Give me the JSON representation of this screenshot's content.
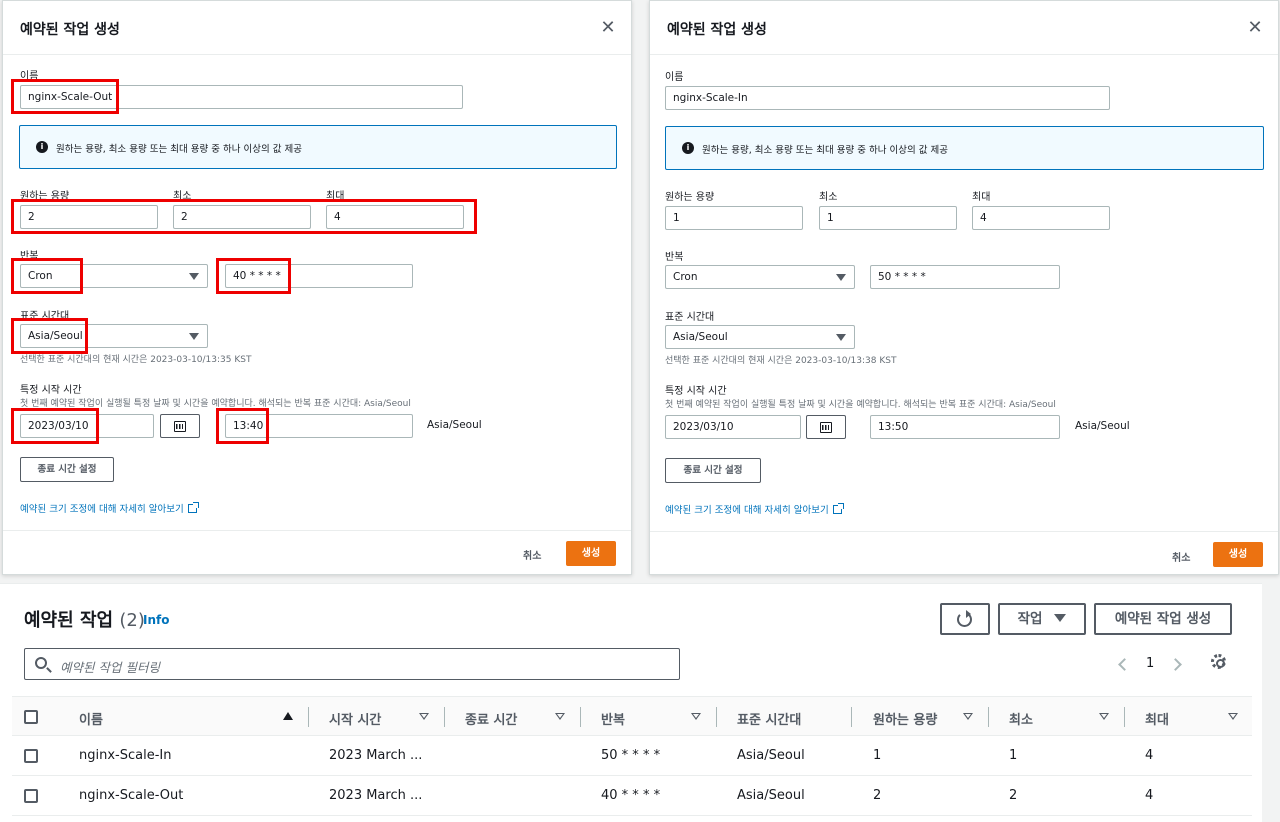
{
  "modals": [
    {
      "title": "예약된 작업 생성",
      "name_label": "이름",
      "name_value": "nginx-Scale-Out",
      "info_text": "원하는 용량, 최소 용량 또는 최대 용량 중 하나 이상의 값 제공",
      "desired_label": "원하는 용량",
      "min_label": "최소",
      "max_label": "최대",
      "desired_value": "2",
      "min_value": "2",
      "max_value": "4",
      "recurrence_label": "반복",
      "recurrence_value": "Cron",
      "cron_value": "40 * * * *",
      "timezone_label": "표준 시간대",
      "timezone_value": "Asia/Seoul",
      "timezone_desc": "선택한 표준 시간대의 현재 시간은 2023-03-10/13:35 KST",
      "start_label": "특정 시작 시간",
      "start_desc": "첫 번째 예약된 작업이 실행될 특정 날짜 및 시간을 예약합니다. 해석되는 반복 표준 시간대: Asia/Seoul",
      "start_date": "2023/03/10",
      "start_time": "13:40",
      "start_tz": "Asia/Seoul",
      "end_time_button": "종료 시간 설정",
      "learn_more": "예약된 크기 조정에 대해 자세히 알아보기",
      "cancel": "취소",
      "create": "생성"
    },
    {
      "title": "예약된 작업 생성",
      "name_label": "이름",
      "name_value": "nginx-Scale-In",
      "info_text": "원하는 용량, 최소 용량 또는 최대 용량 중 하나 이상의 값 제공",
      "desired_label": "원하는 용량",
      "min_label": "최소",
      "max_label": "최대",
      "desired_value": "1",
      "min_value": "1",
      "max_value": "4",
      "recurrence_label": "반복",
      "recurrence_value": "Cron",
      "cron_value": "50 * * * *",
      "timezone_label": "표준 시간대",
      "timezone_value": "Asia/Seoul",
      "timezone_desc": "선택한 표준 시간대의 현재 시간은 2023-03-10/13:38 KST",
      "start_label": "특정 시작 시간",
      "start_desc": "첫 번째 예약된 작업이 실행될 특정 날짜 및 시간을 예약합니다. 해석되는 반복 표준 시간대: Asia/Seoul",
      "start_date": "2023/03/10",
      "start_time": "13:50",
      "start_tz": "Asia/Seoul",
      "end_time_button": "종료 시간 설정",
      "learn_more": "예약된 크기 조정에 대해 자세히 알아보기",
      "cancel": "취소",
      "create": "생성"
    }
  ],
  "table": {
    "title": "예약된 작업",
    "count": "(2)",
    "info": "Info",
    "actions_button": "작업",
    "create_button": "예약된 작업 생성",
    "search_placeholder": "예약된 작업 필터링",
    "page": "1",
    "columns": [
      "이름",
      "시작 시간",
      "종료 시간",
      "반복",
      "표준 시간대",
      "원하는 용량",
      "최소",
      "최대"
    ],
    "rows": [
      {
        "name": "nginx-Scale-In",
        "start": "2023 March ...",
        "end": "",
        "recurrence": "50 * * * *",
        "tz": "Asia/Seoul",
        "desired": "1",
        "min": "1",
        "max": "4"
      },
      {
        "name": "nginx-Scale-Out",
        "start": "2023 March ...",
        "end": "",
        "recurrence": "40 * * * *",
        "tz": "Asia/Seoul",
        "desired": "2",
        "min": "2",
        "max": "4"
      }
    ]
  },
  "colors": {
    "primary": "#ec7211",
    "link": "#0073bb",
    "highlight": "#ee0000"
  }
}
